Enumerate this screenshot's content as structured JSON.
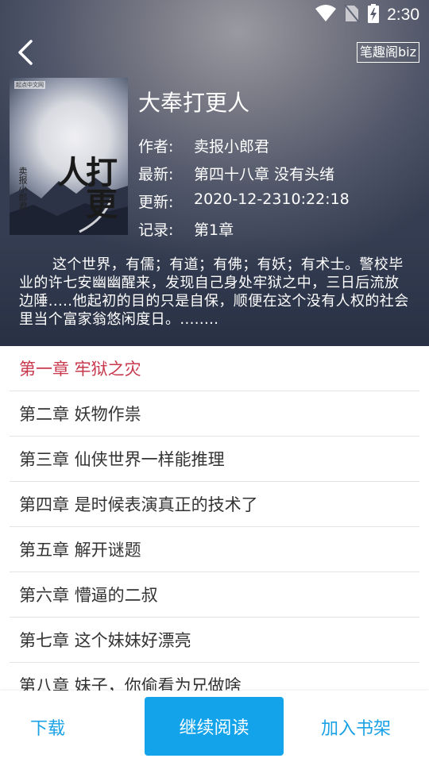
{
  "status": {
    "time": "2:30"
  },
  "header": {
    "source": "笔趣阁biz"
  },
  "book": {
    "title": "大奉打更人",
    "cover": {
      "title_text": "打更人",
      "author_text": "卖报小郎君",
      "publisher": "起点中文网"
    },
    "info": [
      {
        "key": "作者:",
        "value": "卖报小郎君"
      },
      {
        "key": "最新:",
        "value": "第四十八章 没有头绪"
      },
      {
        "key": "更新:",
        "value": "2020-12-2310:22:18"
      },
      {
        "key": "记录:",
        "value": "第1章"
      }
    ],
    "summary": "这个世界，有儒；有道；有佛；有妖；有术士。警校毕业的许七安幽幽醒来，发现自己身处牢狱之中，三日后流放边陲.....他起初的目的只是自保，顺便在这个没有人权的社会里当个富家翁悠闲度日。........"
  },
  "chapters": [
    {
      "label": "第一章 牢狱之灾",
      "active": true
    },
    {
      "label": "第二章 妖物作祟"
    },
    {
      "label": "第三章 仙侠世界一样能推理"
    },
    {
      "label": "第四章 是时候表演真正的技术了"
    },
    {
      "label": "第五章 解开谜题"
    },
    {
      "label": "第六章 懵逼的二叔"
    },
    {
      "label": "第七章 这个妹妹好漂亮"
    },
    {
      "label": "第八章 妹子，你偷看为兄做啥"
    }
  ],
  "actions": {
    "download": "下载",
    "continue": "继续阅读",
    "add_shelf": "加入书架"
  },
  "colors": {
    "accent": "#13a3ea",
    "active_chapter": "#c8384d"
  },
  "icons": [
    "wifi-icon",
    "no-sim-icon",
    "battery-charging-icon",
    "back-arrow-icon"
  ]
}
